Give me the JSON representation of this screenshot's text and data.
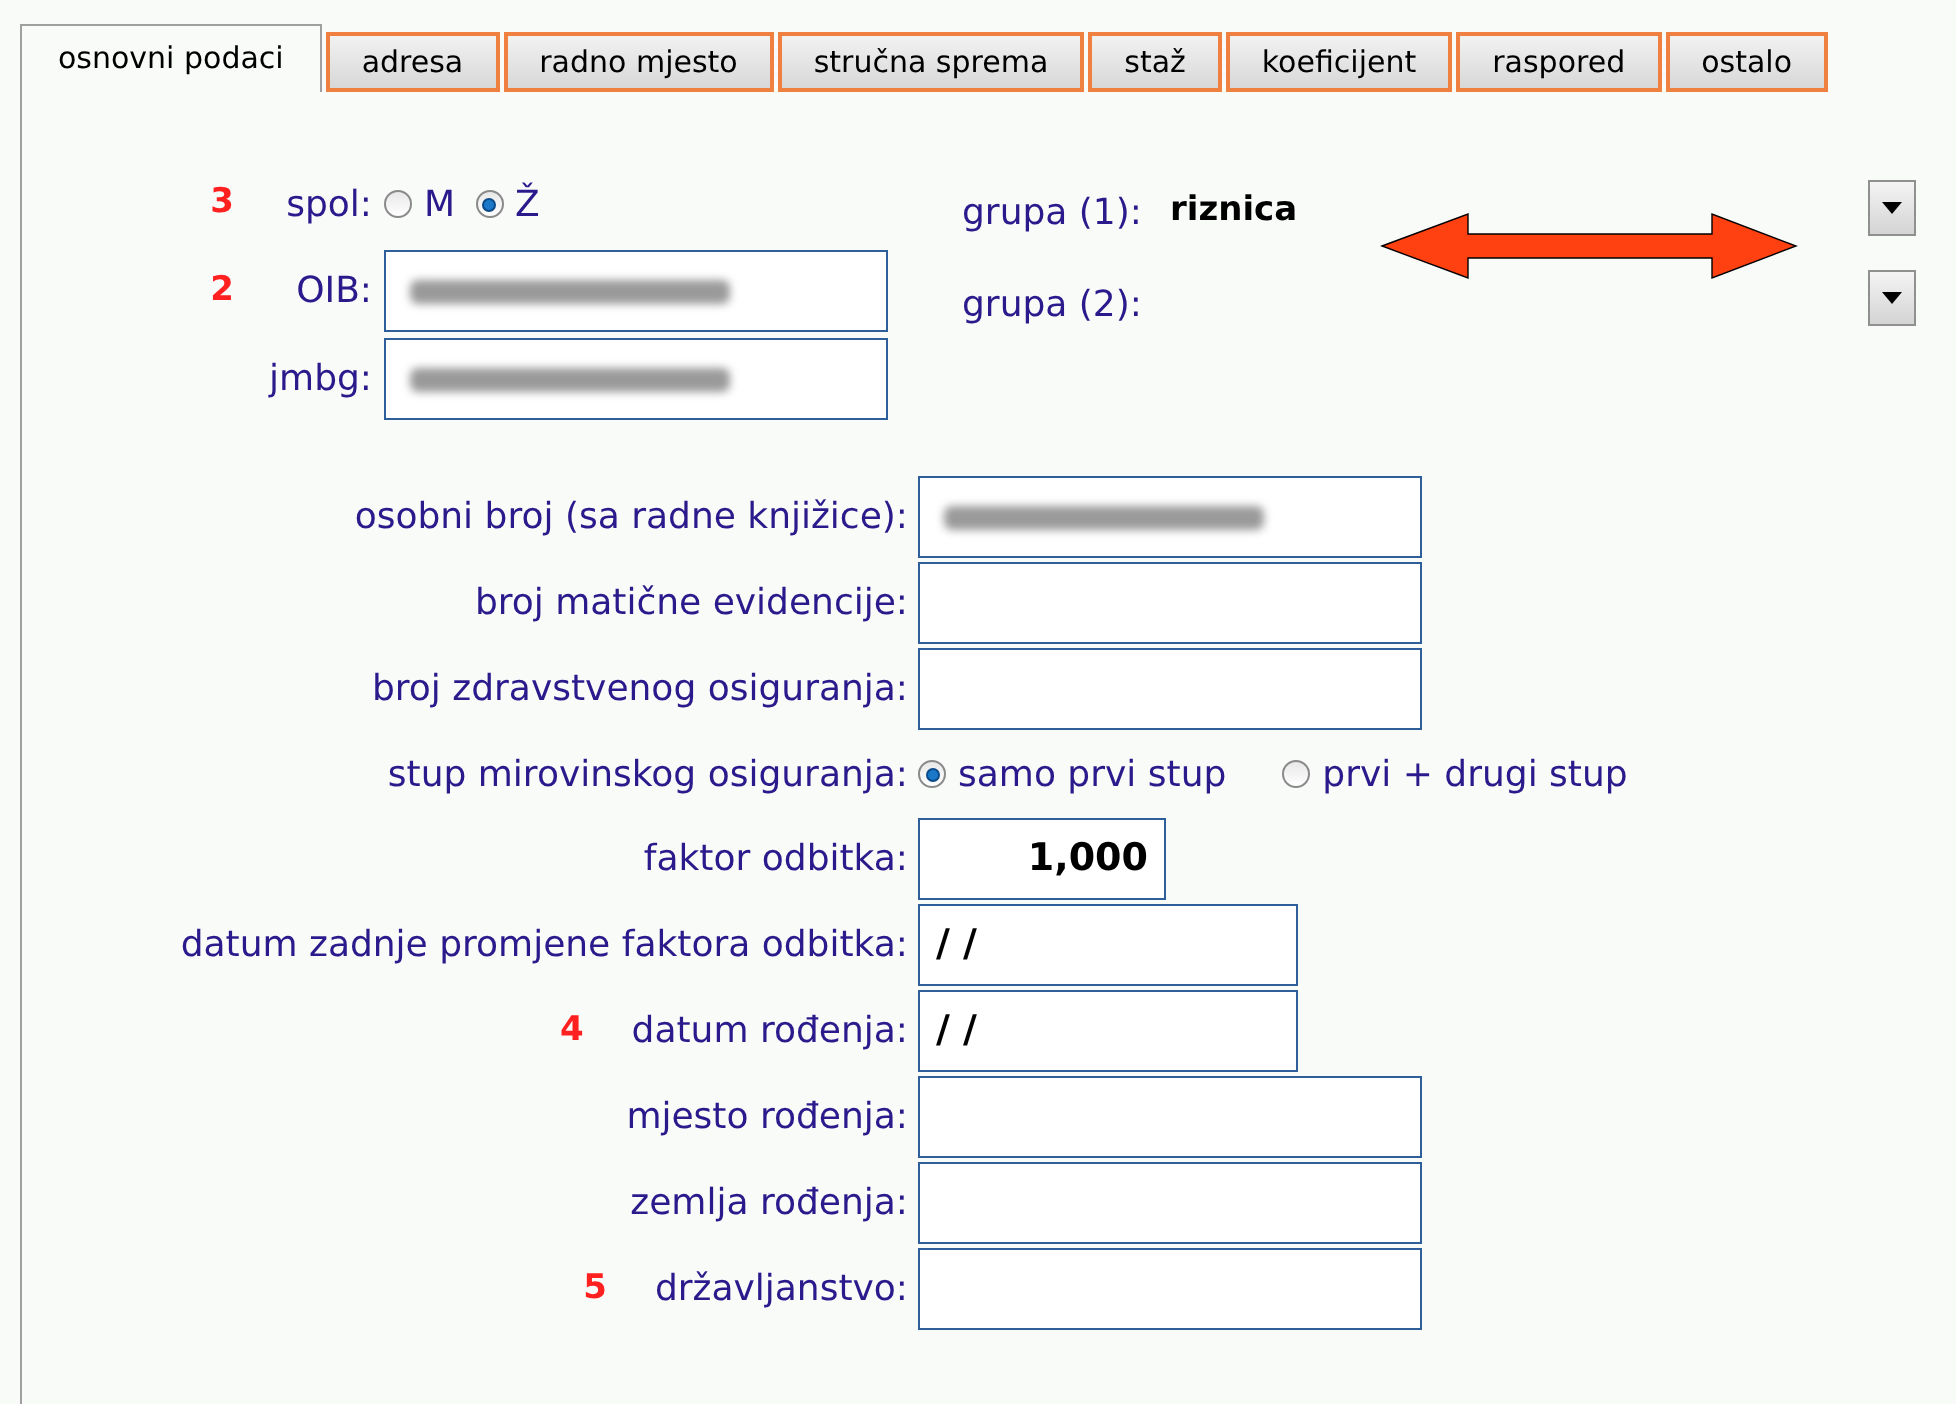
{
  "tabs": [
    {
      "label": "osnovni podaci",
      "selected": true
    },
    {
      "label": "adresa",
      "selected": false
    },
    {
      "label": "radno mjesto",
      "selected": false
    },
    {
      "label": "stručna sprema",
      "selected": false
    },
    {
      "label": "staž",
      "selected": false
    },
    {
      "label": "koeficijent",
      "selected": false
    },
    {
      "label": "raspored",
      "selected": false
    },
    {
      "label": "ostalo",
      "selected": false
    }
  ],
  "gender": {
    "number": "3",
    "label": "spol:",
    "options": [
      {
        "label": "M",
        "selected": false
      },
      {
        "label": "Ž",
        "selected": true
      }
    ]
  },
  "id_fields": [
    {
      "number": "2",
      "label": "OIB:",
      "blurred": true
    },
    {
      "label": "jmbg:",
      "blurred": true
    }
  ],
  "groups": [
    {
      "label": "grupa (1):",
      "value": "riznica"
    },
    {
      "label": "grupa (2):"
    }
  ],
  "form_rows": [
    {
      "kind": "text",
      "label": "osobni broj (sa radne knjižice):",
      "blurred": true
    },
    {
      "kind": "text",
      "label": "broj matične evidencije:"
    },
    {
      "kind": "text",
      "label": "broj zdravstvenog osiguranja:"
    },
    {
      "kind": "radio",
      "label": "stup mirovinskog osiguranja:",
      "options": [
        {
          "label": "samo prvi stup",
          "selected": true
        },
        {
          "label": "prvi + drugi stup",
          "selected": false
        }
      ]
    },
    {
      "kind": "number",
      "label": "faktor odbitka:",
      "value": "1,000"
    },
    {
      "kind": "date",
      "label": "datum zadnje promjene faktora odbitka:",
      "value": "/ /"
    },
    {
      "kind": "date",
      "number": "4",
      "label": "datum rođenja:",
      "value": "/ /"
    },
    {
      "kind": "text",
      "label": "mjesto rođenja:"
    },
    {
      "kind": "text",
      "label": "zemlja rođenja:"
    },
    {
      "kind": "text",
      "number": "5",
      "label": "državljanstvo:"
    }
  ]
}
